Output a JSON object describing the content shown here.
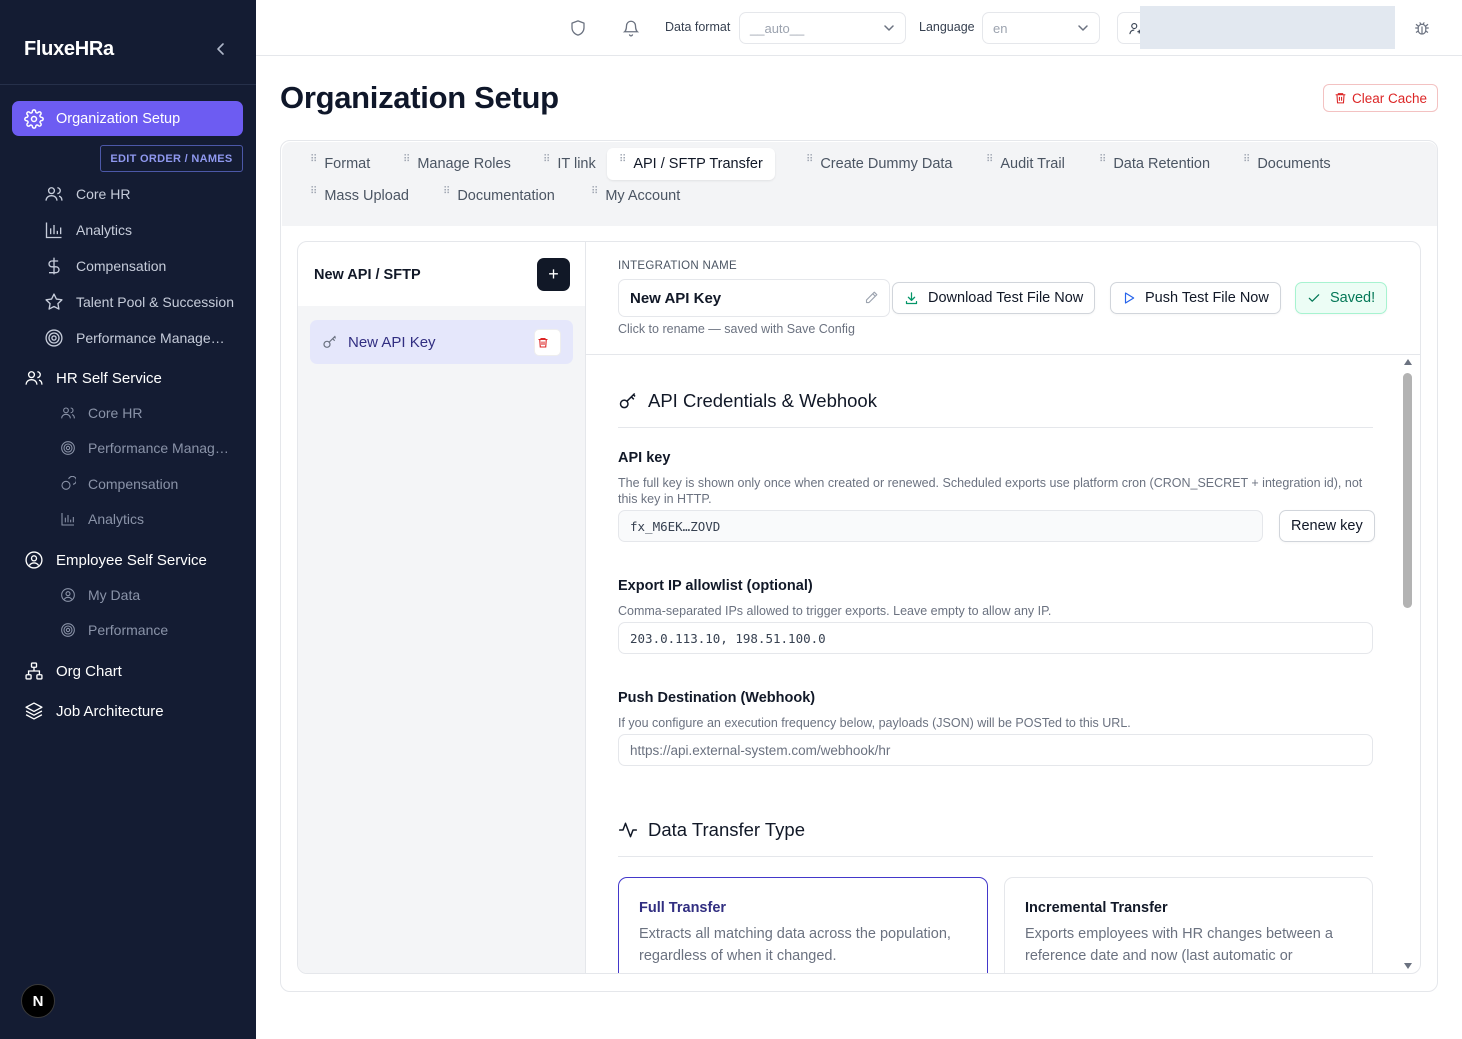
{
  "app": {
    "brand": "FluxeHRa"
  },
  "sidebar": {
    "active_item": "Organization Setup",
    "edit_order_label": "EDIT ORDER / NAMES",
    "org_setup_children": [
      {
        "label": "Core HR",
        "icon": "users-icon"
      },
      {
        "label": "Analytics",
        "icon": "bar-chart-icon"
      },
      {
        "label": "Compensation",
        "icon": "dollar-icon"
      },
      {
        "label": "Talent Pool & Succession",
        "icon": "star-icon"
      },
      {
        "label": "Performance Manage…",
        "icon": "target-icon"
      }
    ],
    "hr_self_service": {
      "label": "HR Self Service",
      "children": [
        {
          "label": "Core HR",
          "icon": "users-icon"
        },
        {
          "label": "Performance Manag…",
          "icon": "target-icon"
        },
        {
          "label": "Compensation",
          "icon": "coins-icon"
        },
        {
          "label": "Analytics",
          "icon": "bar-chart-icon"
        }
      ]
    },
    "employee_self_service": {
      "label": "Employee Self Service",
      "children": [
        {
          "label": "My Data",
          "icon": "user-circle-icon"
        },
        {
          "label": "Performance",
          "icon": "target-icon"
        }
      ]
    },
    "org_chart": "Org Chart",
    "job_architecture": "Job Architecture",
    "badge": "N"
  },
  "topbar": {
    "data_format_label": "Data format",
    "data_format_value": "__auto__",
    "language_label": "Language",
    "language_value": "en"
  },
  "page": {
    "title": "Organization Setup",
    "clear_cache": "Clear Cache"
  },
  "tabs": [
    "Format",
    "Manage Roles",
    "IT link",
    "API / SFTP Transfer",
    "Create Dummy Data",
    "Audit Trail",
    "Data Retention",
    "Documents",
    "Mass Upload",
    "Documentation",
    "My Account"
  ],
  "active_tab": "API / SFTP Transfer",
  "integrations": {
    "header": "New API / SFTP",
    "add_label": "+",
    "items": [
      {
        "name": "New API Key"
      }
    ]
  },
  "detail": {
    "integration_name_label": "INTEGRATION NAME",
    "integration_name_value": "New API Key",
    "rename_hint": "Click to rename — saved with Save Config",
    "download_button": "Download Test File Now",
    "push_button": "Push Test File Now",
    "saved_button": "Saved!",
    "credentials": {
      "title": "API Credentials & Webhook",
      "api_key_label": "API key",
      "api_key_help": "The full key is shown only once when created or renewed. Scheduled exports use platform cron (CRON_SECRET + integration id), not this key in HTTP.",
      "api_key_value": "fx_M6EK…ZOVD",
      "renew_button": "Renew key",
      "ip_label": "Export IP allowlist (optional)",
      "ip_help": "Comma-separated IPs allowed to trigger exports. Leave empty to allow any IP.",
      "ip_value": "203.0.113.10, 198.51.100.0",
      "webhook_label": "Push Destination (Webhook)",
      "webhook_help": "If you configure an execution frequency below, payloads (JSON) will be POSTed to this URL.",
      "webhook_placeholder": "https://api.external-system.com/webhook/hr"
    },
    "transfer": {
      "title": "Data Transfer Type",
      "options": [
        {
          "title": "Full Transfer",
          "desc": "Extracts all matching data across the population, regardless of when it changed.",
          "selected": true
        },
        {
          "title": "Incremental Transfer",
          "desc": "Exports employees with HR changes between a reference date and now (last automatic or",
          "selected": false
        }
      ]
    }
  },
  "colors": {
    "sidebar_bg": "#141c33",
    "accent": "#6d5cf2",
    "danger": "#dc2626",
    "success": "#047857"
  }
}
